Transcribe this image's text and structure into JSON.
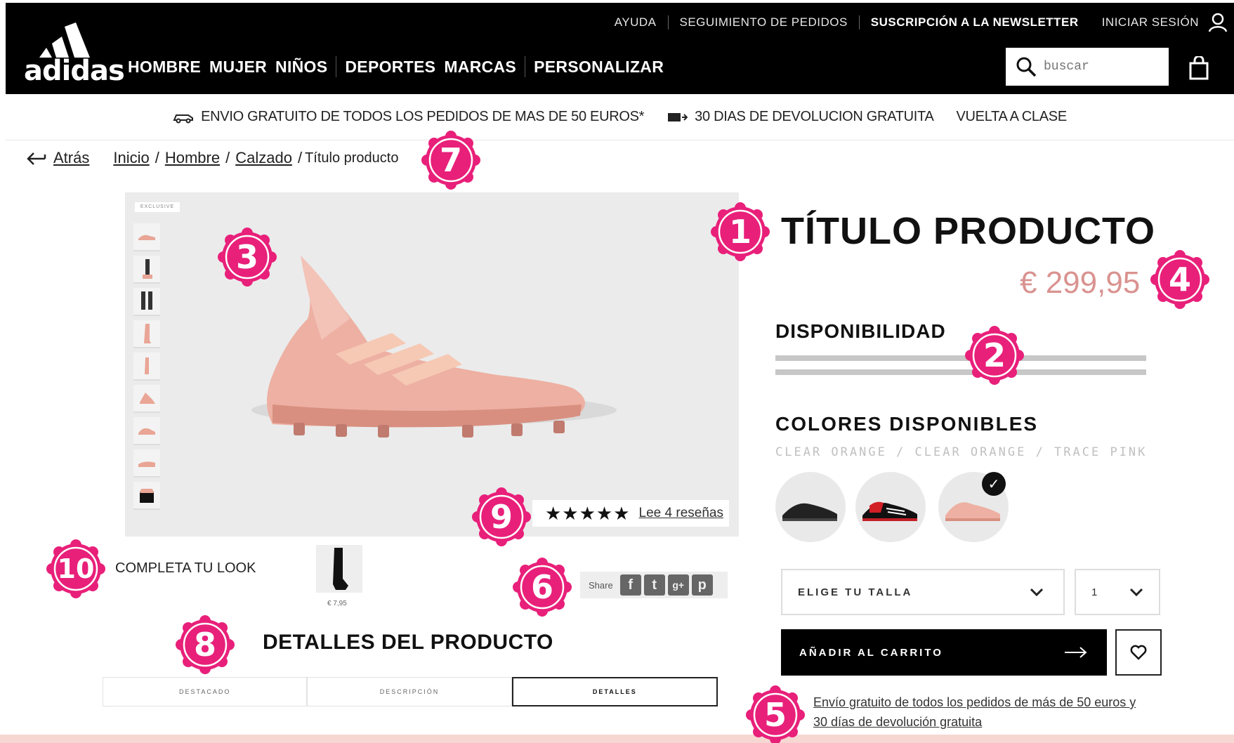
{
  "header": {
    "top_links": [
      "AYUDA",
      "SEGUIMIENTO DE PEDIDOS",
      "SUSCRIPCIÓN A LA NEWSLETTER",
      "INICIAR SESIÓN"
    ],
    "logo_text": "adidas",
    "nav": [
      "HOMBRE",
      "MUJER",
      "NIÑOS",
      "DEPORTES",
      "MARCAS",
      "PERSONALIZAR"
    ],
    "search_placeholder": "buscar"
  },
  "promo": {
    "shipping": "ENVIO GRATUITO DE TODOS LOS PEDIDOS DE MAS DE 50 EUROS*",
    "returns": "30 DIAS DE DEVOLUCION GRATUITA",
    "campaign": "VUELTA A CLASE"
  },
  "breadcrumb": {
    "back": "Atrás",
    "items": [
      "Inicio",
      "Hombre",
      "Calzado"
    ],
    "current": "Título producto"
  },
  "gallery": {
    "badge": "EXCLUSIVE",
    "stars": "★★★★★",
    "reviews_link": "Lee 4 reseñas"
  },
  "look": {
    "label": "COMPLETA TU LOOK",
    "price": "€ 7,95"
  },
  "share": {
    "label": "Share",
    "icons": [
      "facebook-icon",
      "twitter-icon",
      "google-plus-icon",
      "pinterest-icon"
    ]
  },
  "details": {
    "title": "DETALLES DEL PRODUCTO",
    "tabs": [
      "DESTACADO",
      "DESCRIPCIÓN",
      "DETALLES"
    ],
    "active_tab": "DETALLES"
  },
  "product": {
    "title": "TÍTULO PRODUCTO",
    "price": "€ 299,95",
    "availability_label": "DISPONIBILIDAD",
    "colors_label": "COLORES DISPONIBLES",
    "colors_value": "CLEAR ORANGE / CLEAR ORANGE / TRACE PINK",
    "selected_color_index": 2,
    "size_placeholder": "ELIGE TU TALLA",
    "quantity": "1",
    "add_to_cart": "AÑADIR AL CARRITO",
    "shipping_note": "Envío gratuito de todos los pedidos de más de 50 euros y 30 días de devolución gratuita"
  },
  "annotations": [
    "1",
    "2",
    "3",
    "4",
    "5",
    "6",
    "7",
    "8",
    "9",
    "10"
  ],
  "colors": {
    "badge": "#e8207a",
    "price": "#d99390",
    "shoe_pink": "#e9a595",
    "header_bg": "#000000"
  }
}
